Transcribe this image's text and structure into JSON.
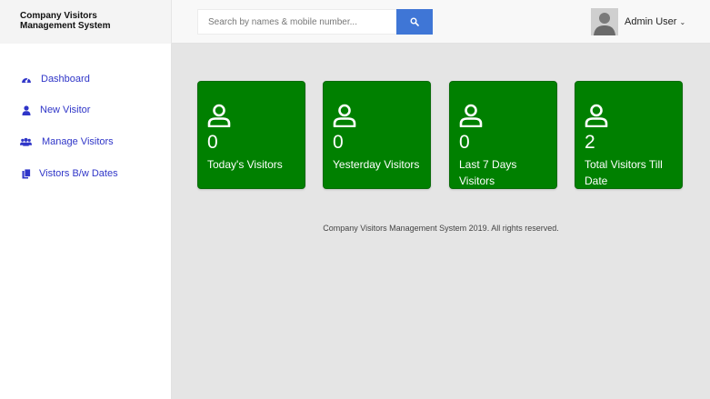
{
  "brand": {
    "line1": "Company Visitors",
    "line2": "Management System"
  },
  "search": {
    "placeholder": "Search by names & mobile number..."
  },
  "user": {
    "name": "Admin User"
  },
  "sidebar": {
    "items": [
      {
        "label": "Dashboard",
        "icon": "dashboard-icon"
      },
      {
        "label": "New Visitor",
        "icon": "user-icon"
      },
      {
        "label": "Manage Visitors",
        "icon": "users-icon"
      },
      {
        "label": "Vistors B/w Dates",
        "icon": "files-icon"
      }
    ]
  },
  "stats": [
    {
      "value": "0",
      "label": "Today's Visitors"
    },
    {
      "value": "0",
      "label": "Yesterday Visitors"
    },
    {
      "value": "0",
      "label": "Last 7 Days Visitors"
    },
    {
      "value": "2",
      "label": "Total Visitors Till Date"
    }
  ],
  "footer": {
    "text": "Company Visitors Management System 2019. All rights reserved."
  },
  "colors": {
    "card": "#008000",
    "accent": "#3f76d6",
    "nav_text": "#2f35c8"
  }
}
